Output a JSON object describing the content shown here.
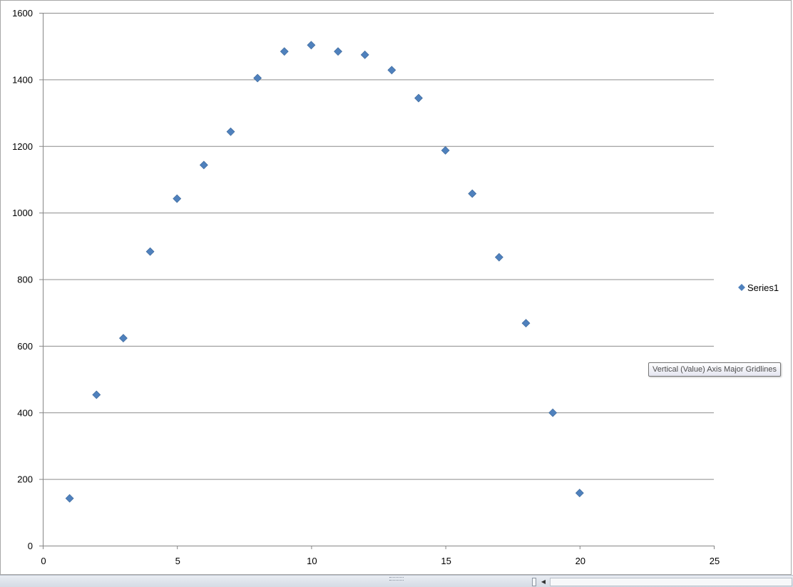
{
  "chart_data": {
    "type": "scatter",
    "xlim": [
      0,
      25
    ],
    "ylim": [
      0,
      1600
    ],
    "x_ticks": [
      0,
      5,
      10,
      15,
      20,
      25
    ],
    "y_ticks": [
      0,
      200,
      400,
      600,
      800,
      1000,
      1200,
      1400,
      1600
    ],
    "grid": "horizontal major gridlines",
    "legend_position": "right",
    "series": [
      {
        "name": "Series1",
        "color": "#4f81bd",
        "marker": "diamond",
        "points": [
          {
            "x": 1,
            "y": 142
          },
          {
            "x": 2,
            "y": 453
          },
          {
            "x": 3,
            "y": 623
          },
          {
            "x": 4,
            "y": 883
          },
          {
            "x": 5,
            "y": 1042
          },
          {
            "x": 6,
            "y": 1143
          },
          {
            "x": 7,
            "y": 1243
          },
          {
            "x": 8,
            "y": 1404
          },
          {
            "x": 9,
            "y": 1484
          },
          {
            "x": 10,
            "y": 1503
          },
          {
            "x": 11,
            "y": 1484
          },
          {
            "x": 12,
            "y": 1474
          },
          {
            "x": 13,
            "y": 1428
          },
          {
            "x": 14,
            "y": 1344
          },
          {
            "x": 15,
            "y": 1187
          },
          {
            "x": 16,
            "y": 1057
          },
          {
            "x": 17,
            "y": 866
          },
          {
            "x": 18,
            "y": 668
          },
          {
            "x": 19,
            "y": 399
          },
          {
            "x": 20,
            "y": 158
          }
        ]
      }
    ]
  },
  "tooltip": {
    "text": "Vertical (Value) Axis Major Gridlines"
  },
  "colors": {
    "gridline": "#8c8c8c",
    "axis": "#868686",
    "marker": "#4f81bd"
  }
}
